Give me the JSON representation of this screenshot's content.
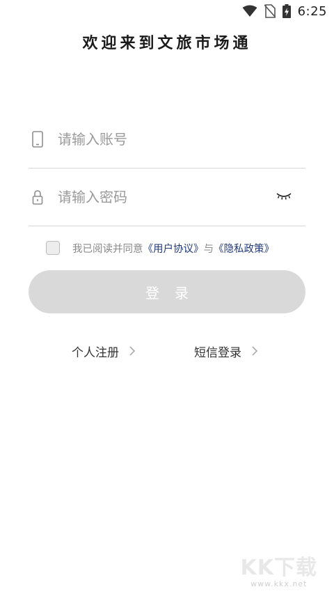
{
  "status_bar": {
    "time": "6:25",
    "icons": [
      "wifi-icon",
      "no-sim-icon",
      "battery-charging-icon"
    ]
  },
  "title": "欢迎来到文旅市场通",
  "account_field": {
    "placeholder": "请输入账号",
    "icon": "phone-icon"
  },
  "password_field": {
    "placeholder": "请输入密码",
    "icon": "lock-icon",
    "toggle_icon": "eye-closed-icon"
  },
  "agreement": {
    "prefix": "我已阅读并同意",
    "user_agreement": "《用户协议》",
    "conjunction": "与",
    "privacy_policy": "《隐私政策》",
    "checked": false
  },
  "login_button": "登录",
  "links": {
    "register": "个人注册",
    "sms_login": "短信登录"
  },
  "watermark": {
    "brand": "KK下载",
    "url": "www.kkx.net"
  },
  "colors": {
    "link": "#223a7a",
    "button_disabled": "#d9d9d9",
    "placeholder": "#9a9a9a"
  }
}
